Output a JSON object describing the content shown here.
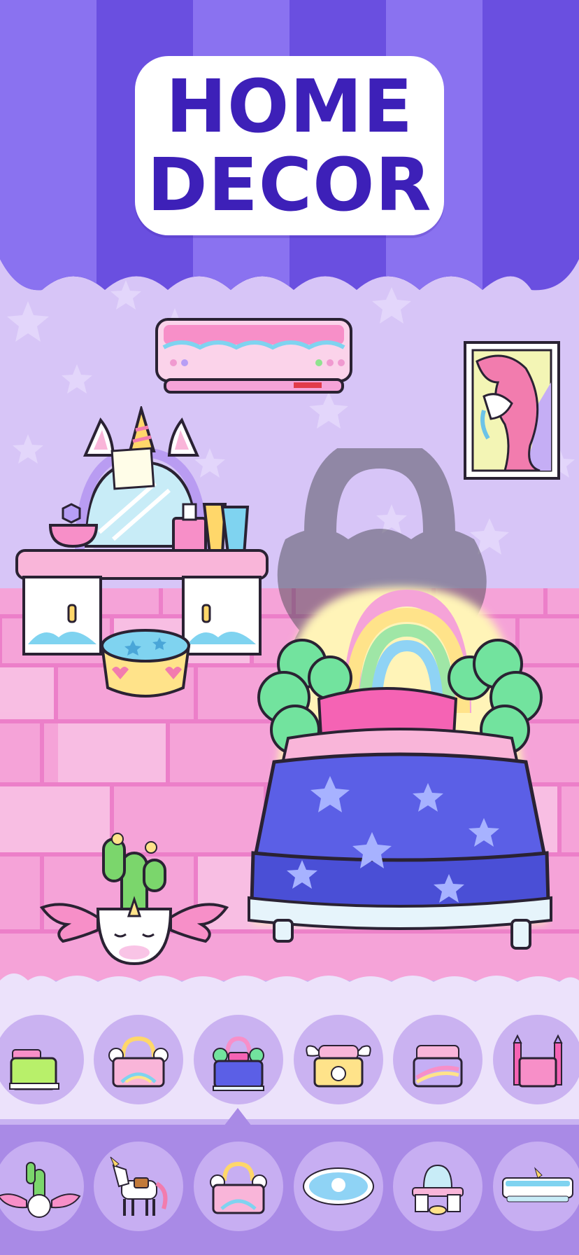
{
  "title": {
    "line1": "HOME",
    "line2": "DECOR"
  },
  "colors": {
    "awning_dark": "#6a4fe0",
    "awning_light": "#8a72f0",
    "title_text": "#3d20b8",
    "wall": "#d7c5f7",
    "floor_pink": "#f7a8dc",
    "tray_light": "#ece2fb",
    "tray_dark": "#a98ae6",
    "slot": "#cab2f1"
  },
  "room_items": [
    {
      "name": "air-conditioner",
      "locked": false
    },
    {
      "name": "unicorn-portrait",
      "locked": false
    },
    {
      "name": "unicorn-vanity-table",
      "locked": false
    },
    {
      "name": "star-pouf",
      "locked": false
    },
    {
      "name": "locked-item",
      "locked": true
    },
    {
      "name": "rainbow-star-bed",
      "locked": false,
      "selected": true
    },
    {
      "name": "winged-unicorn-cactus",
      "locked": false
    }
  ],
  "bed_options": [
    {
      "name": "green-bed",
      "selected": false
    },
    {
      "name": "rainbow-cloud-bed",
      "selected": false
    },
    {
      "name": "star-blanket-bed",
      "selected": true
    },
    {
      "name": "winged-unicorn-bed",
      "selected": false
    },
    {
      "name": "rainbow-stripe-bed",
      "selected": false
    },
    {
      "name": "castle-bed",
      "selected": false
    }
  ],
  "category_options": [
    {
      "name": "cactus-category",
      "selected": false
    },
    {
      "name": "unicorn-category",
      "selected": false
    },
    {
      "name": "bed-category",
      "selected": true
    },
    {
      "name": "rug-category",
      "selected": false
    },
    {
      "name": "vanity-category",
      "selected": false
    },
    {
      "name": "air-conditioner-category",
      "selected": false
    }
  ]
}
